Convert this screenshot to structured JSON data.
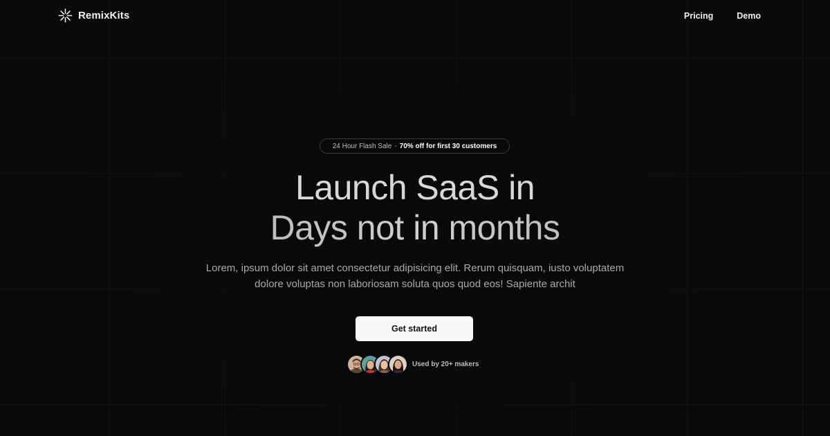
{
  "brand": {
    "name": "RemixKits",
    "logo_icon": "asterisk-burst-icon"
  },
  "nav": {
    "items": [
      {
        "label": "Pricing"
      },
      {
        "label": "Demo"
      }
    ]
  },
  "hero": {
    "badge": {
      "prefix": "24 Hour Flash Sale",
      "separator": "-",
      "highlight": "70% off for first 30 customers"
    },
    "headline_line1": "Launch SaaS in",
    "headline_line2": "Days not in months",
    "subtitle": "Lorem, ipsum dolor sit amet consectetur adipisicing elit. Rerum quisquam, iusto voluptatem dolore voluptas non laboriosam soluta quos quod eos! Sapiente archit",
    "cta_label": "Get started",
    "social_proof": {
      "text": "Used by 20+ makers",
      "avatar_count": 4
    }
  },
  "colors": {
    "background": "#0a0a0c",
    "cta_background": "#f7f7f7",
    "text_primary": "#f0f0f0",
    "text_muted": "#a9a9a9"
  }
}
